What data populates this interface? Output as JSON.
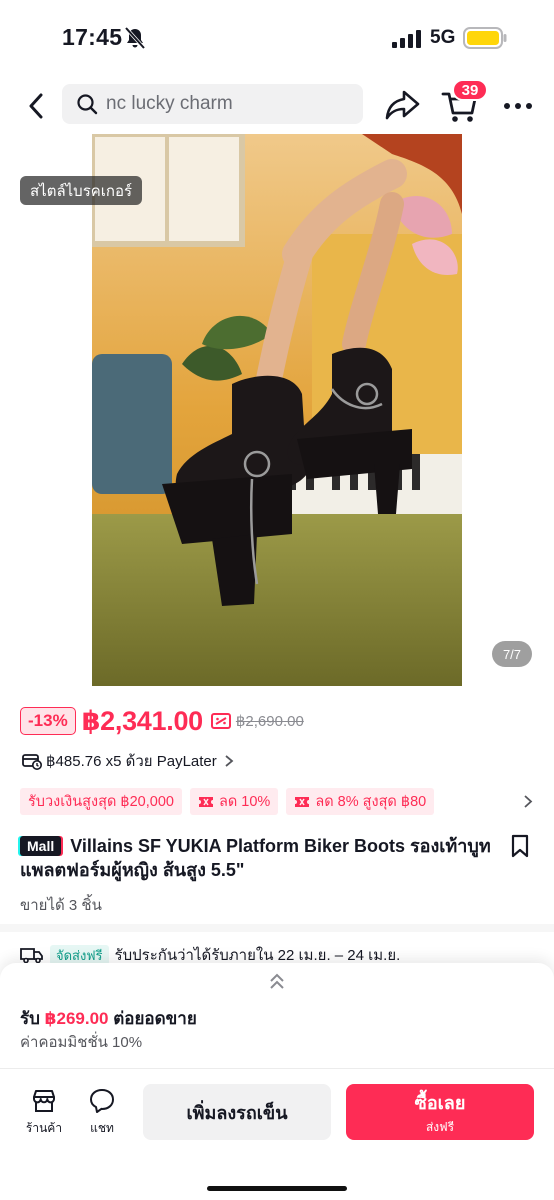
{
  "status_bar": {
    "time": "17:45",
    "network": "5G"
  },
  "header": {
    "search_text": "nc lucky charm",
    "cart_count": "39"
  },
  "image": {
    "style_tag": "สไตล์ไบรคเกอร์",
    "counter": "7/7"
  },
  "price": {
    "discount": "-13%",
    "current": "฿2,341.00",
    "original": "฿2,690.00"
  },
  "paylater": {
    "text": "฿485.76 x5 ด้วย PayLater"
  },
  "coupons": [
    {
      "label": "รับวงเงินสูงสุด ฿20,000",
      "icon": "none"
    },
    {
      "label": "ลด 10%",
      "icon": "coupon-icon"
    },
    {
      "label": "ลด 8% สูงสุด ฿80",
      "icon": "coupon-icon"
    }
  ],
  "product": {
    "mall_badge": "Mall",
    "title": "Villains SF YUKIA Platform Biker Boots รองเท้าบูทแพลตฟอร์มผู้หญิง ส้นสูง 5.5\"",
    "sold": "ขายได้ 3 ชิ้น"
  },
  "shipping": {
    "badge": "จัดส่งฟรี",
    "text": "รับประกันว่าได้รับภายใน 22 เม.ย. – 24 เม.ย."
  },
  "commission": {
    "earn_prefix": "รับ",
    "earn_amount": "฿269.00",
    "earn_suffix": "ต่อยอดขาย",
    "rate_text": "ค่าคอมมิชชั่น 10%"
  },
  "actions": {
    "store_label": "ร้านค้า",
    "chat_label": "แชท",
    "add_to_cart": "เพิ่มลงรถเข็น",
    "buy_now": "ซื้อเลย",
    "buy_sub": "ส่งฟรี"
  },
  "colors": {
    "accent": "#fe2c55",
    "teal": "#109e8a",
    "text": "#161823"
  }
}
